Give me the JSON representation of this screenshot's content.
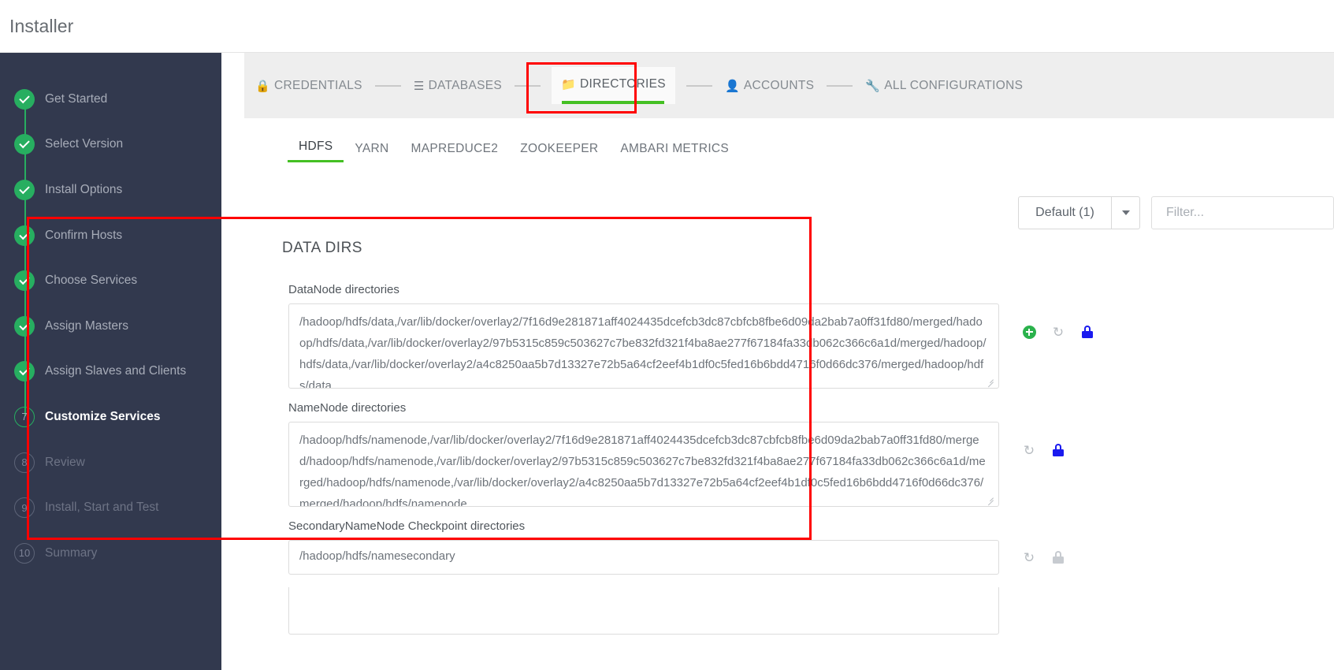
{
  "window": {
    "app_title": "Installer"
  },
  "sidebar": {
    "steps": [
      {
        "label": "Get Started",
        "marker": "check",
        "state": "done"
      },
      {
        "label": "Select Version",
        "marker": "check",
        "state": "done"
      },
      {
        "label": "Install Options",
        "marker": "check",
        "state": "done"
      },
      {
        "label": "Confirm Hosts",
        "marker": "check",
        "state": "done"
      },
      {
        "label": "Choose Services",
        "marker": "check",
        "state": "done"
      },
      {
        "label": "Assign Masters",
        "marker": "check",
        "state": "done"
      },
      {
        "label": "Assign Slaves and Clients",
        "marker": "check",
        "state": "done"
      },
      {
        "label": "Customize Services",
        "marker": "7",
        "state": "current"
      },
      {
        "label": "Review",
        "marker": "8",
        "state": "todo"
      },
      {
        "label": "Install, Start and Test",
        "marker": "9",
        "state": "todo"
      },
      {
        "label": "Summary",
        "marker": "10",
        "state": "todo"
      }
    ]
  },
  "wizard_nav": {
    "items": [
      {
        "label": "CREDENTIALS",
        "icon": "lock-icon",
        "glyph": "🔒",
        "active": false
      },
      {
        "label": "DATABASES",
        "icon": "database-icon",
        "glyph": "☰",
        "active": false
      },
      {
        "label": "DIRECTORIES",
        "icon": "folder-icon",
        "glyph": "📁",
        "active": true
      },
      {
        "label": "ACCOUNTS",
        "icon": "user-icon",
        "glyph": "👤",
        "active": false
      },
      {
        "label": "ALL CONFIGURATIONS",
        "icon": "wrench-icon",
        "glyph": "🔧",
        "active": false
      }
    ]
  },
  "service_tabs": [
    {
      "label": "HDFS",
      "active": true
    },
    {
      "label": "YARN",
      "active": false
    },
    {
      "label": "MAPREDUCE2",
      "active": false
    },
    {
      "label": "ZOOKEEPER",
      "active": false
    },
    {
      "label": "AMBARI METRICS",
      "active": false
    }
  ],
  "toolbar": {
    "config_group": "Default (1)",
    "filter_placeholder": "Filter..."
  },
  "section": {
    "title": "DATA DIRS",
    "fields": [
      {
        "label": "DataNode directories",
        "value": "/hadoop/hdfs/data,/var/lib/docker/overlay2/7f16d9e281871aff4024435dcefcb3dc87cbfcb8fbe6d09da2bab7a0ff31fd80/merged/hadoop/hdfs/data,/var/lib/docker/overlay2/97b5315c859c503627c7be832fd321f4ba8ae277f67184fa33db062c366c6a1d/merged/hadoop/hdfs/data,/var/lib/docker/overlay2/a4c8250aa5b7d13327e72b5a64cf2eef4b1df0c5fed16b6bdd4716f0d66dc376/merged/hadoop/hdfs/data",
        "icons": [
          "add-icon",
          "revert-icon",
          "lock-icon"
        ],
        "lock_state": "locked"
      },
      {
        "label": "NameNode directories",
        "value": "/hadoop/hdfs/namenode,/var/lib/docker/overlay2/7f16d9e281871aff4024435dcefcb3dc87cbfcb8fbe6d09da2bab7a0ff31fd80/merged/hadoop/hdfs/namenode,/var/lib/docker/overlay2/97b5315c859c503627c7be832fd321f4ba8ae277f67184fa33db062c366c6a1d/merged/hadoop/hdfs/namenode,/var/lib/docker/overlay2/a4c8250aa5b7d13327e72b5a64cf2eef4b1df0c5fed16b6bdd4716f0d66dc376/merged/hadoop/hdfs/namenode",
        "icons": [
          "revert-icon",
          "lock-icon"
        ],
        "lock_state": "locked"
      },
      {
        "label": "SecondaryNameNode Checkpoint directories",
        "value": "/hadoop/hdfs/namesecondary",
        "icons": [
          "revert-icon",
          "lock-icon"
        ],
        "lock_state": "disabled"
      }
    ]
  },
  "colors": {
    "accent_green": "#44c023",
    "step_green": "#27ae60",
    "sidebar_bg": "#32394e",
    "annotation_red": "#ff0000",
    "lock_blue": "#1a1aef"
  }
}
